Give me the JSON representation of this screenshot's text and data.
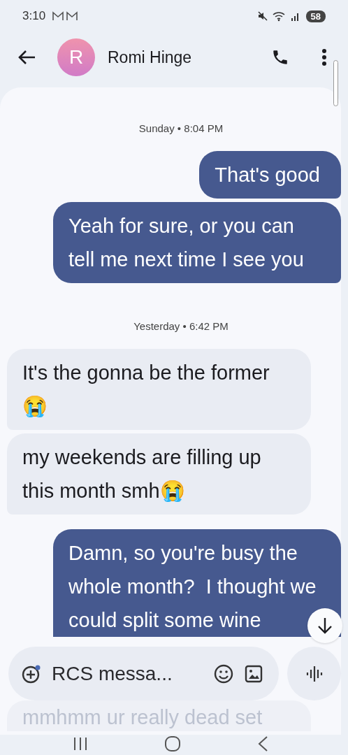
{
  "status_bar": {
    "time": "3:10",
    "battery": "58"
  },
  "header": {
    "avatar_letter": "R",
    "contact_name": "Romi Hinge"
  },
  "messages": [
    {
      "kind": "timestamp",
      "text": "Sunday • 8:04 PM"
    },
    {
      "kind": "sent",
      "text": "That's good"
    },
    {
      "kind": "sent",
      "text": "Yeah for sure, or you can tell me next time I see you"
    },
    {
      "kind": "timestamp",
      "text": "Yesterday • 6:42 PM"
    },
    {
      "kind": "received",
      "text": "It's the gonna be the former😭"
    },
    {
      "kind": "received",
      "text": "my weekends are filling up this month smh😭"
    },
    {
      "kind": "sent",
      "text": "Damn, so you're busy the whole month?  I thought we could split some wine"
    },
    {
      "kind": "received",
      "text": "mmhmm ur really dead set",
      "faded": true
    }
  ],
  "composer": {
    "placeholder": "RCS messa..."
  }
}
